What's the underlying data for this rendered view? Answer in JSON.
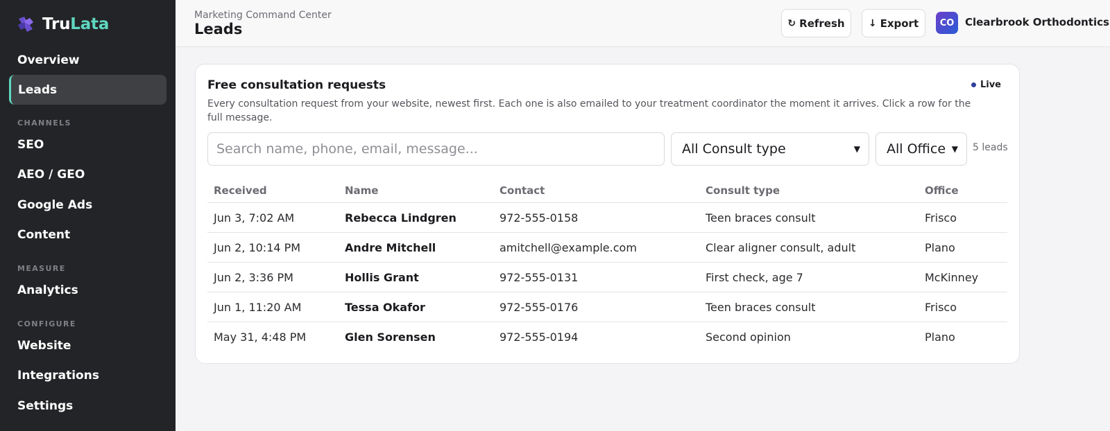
{
  "brand": {
    "name_part1": "Tru",
    "name_part2": "Lata",
    "accent_color": "#5fd6c0"
  },
  "sidebar": {
    "items": [
      {
        "label": "Overview"
      },
      {
        "label": "Leads",
        "active": true
      },
      {
        "label": "SEO"
      },
      {
        "label": "AEO / GEO"
      },
      {
        "label": "Google Ads"
      },
      {
        "label": "Content"
      },
      {
        "label": "Analytics"
      },
      {
        "label": "Website"
      },
      {
        "label": "Integrations"
      },
      {
        "label": "Settings"
      }
    ],
    "sections": {
      "channels": "CHANNELS",
      "measure": "MEASURE",
      "configure": "CONFIGURE"
    }
  },
  "header": {
    "breadcrumb": "Marketing Command Center",
    "title": "Leads",
    "refresh_icon": "↻",
    "refresh_label": "Refresh",
    "export_icon": "↓",
    "export_label": "Export",
    "avatar_initials": "CO",
    "org_name": "Clearbrook Orthodontics"
  },
  "card": {
    "title": "Free consultation requests",
    "live_label": "Live",
    "description": "Every consultation request from your website, newest first. Each one is also emailed to your treatment coordinator the moment it arrives. Click a row for the full message.",
    "search_placeholder": "Search name, phone, email, message...",
    "consult_filter": "All Consult type",
    "office_filter": "All Office",
    "count": "5 leads"
  },
  "table": {
    "columns": [
      "Received",
      "Name",
      "Contact",
      "Consult type",
      "Office"
    ],
    "rows": [
      {
        "received": "Jun 3, 7:02 AM",
        "name": "Rebecca Lindgren",
        "contact": "972-555-0158",
        "consult": "Teen braces consult",
        "office": "Frisco"
      },
      {
        "received": "Jun 2, 10:14 PM",
        "name": "Andre Mitchell",
        "contact": "amitchell@example.com",
        "consult": "Clear aligner consult, adult",
        "office": "Plano"
      },
      {
        "received": "Jun 2, 3:36 PM",
        "name": "Hollis Grant",
        "contact": "972-555-0131",
        "consult": "First check, age 7",
        "office": "McKinney"
      },
      {
        "received": "Jun 1, 11:20 AM",
        "name": "Tessa Okafor",
        "contact": "972-555-0176",
        "consult": "Teen braces consult",
        "office": "Frisco"
      },
      {
        "received": "May 31, 4:48 PM",
        "name": "Glen Sorensen",
        "contact": "972-555-0194",
        "consult": "Second opinion",
        "office": "Plano"
      }
    ]
  },
  "icons": {
    "logo": "puzzle-logo-icon",
    "refresh": "refresh-icon",
    "export": "download-icon",
    "chevron": "chevron-down-icon",
    "live": "status-dot-icon"
  }
}
